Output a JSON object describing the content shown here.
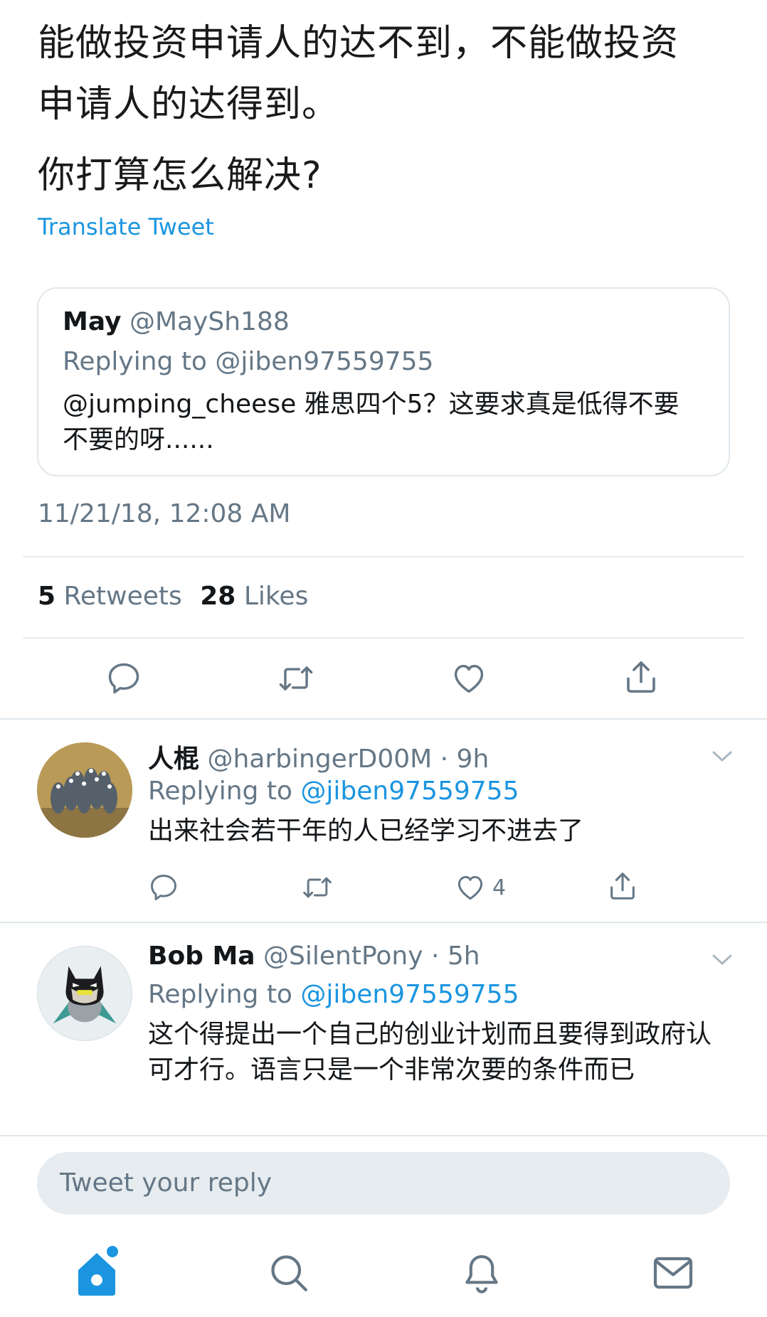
{
  "tweet": {
    "text_line1": "能做投资申请人的达不到，不能做投资",
    "text_line2": "申请人的达得到。",
    "text_question": "你打算怎么解决?",
    "translate_label": "Translate Tweet",
    "timestamp": "11/21/18, 12:08 AM",
    "retweets_count": "5",
    "retweets_label": "Retweets",
    "likes_count": "28",
    "likes_label": "Likes"
  },
  "quoted": {
    "name": "May",
    "handle": "@MaySh188",
    "replying": "Replying to @jiben97559755",
    "text": "@jumping_cheese 雅思四个5？这要求真是低得不要不要的呀......"
  },
  "replies": [
    {
      "name": "人棍",
      "handle_time": "@harbingerD00M · 9h",
      "replying_prefix": "Replying to",
      "replying_handle": "@jiben97559755",
      "text": "出来社会若干年的人已经学习不进去了",
      "likes": "4"
    },
    {
      "name": "Bob Ma",
      "handle_time": "@SilentPony · 5h",
      "replying_prefix": "Replying to",
      "replying_handle": "@jiben97559755",
      "text": "这个得提出一个自己的创业计划而且要得到政府认可才行。语言只是一个非常次要的条件而已"
    }
  ],
  "compose": {
    "placeholder": "Tweet your reply"
  },
  "colors": {
    "accent": "#1b95e0",
    "muted": "#657786",
    "divider": "#e6ecf0"
  },
  "icons": [
    "reply-icon",
    "retweet-icon",
    "like-icon",
    "share-icon",
    "chevron-down-icon",
    "home-icon",
    "search-icon",
    "notifications-icon",
    "messages-icon"
  ]
}
